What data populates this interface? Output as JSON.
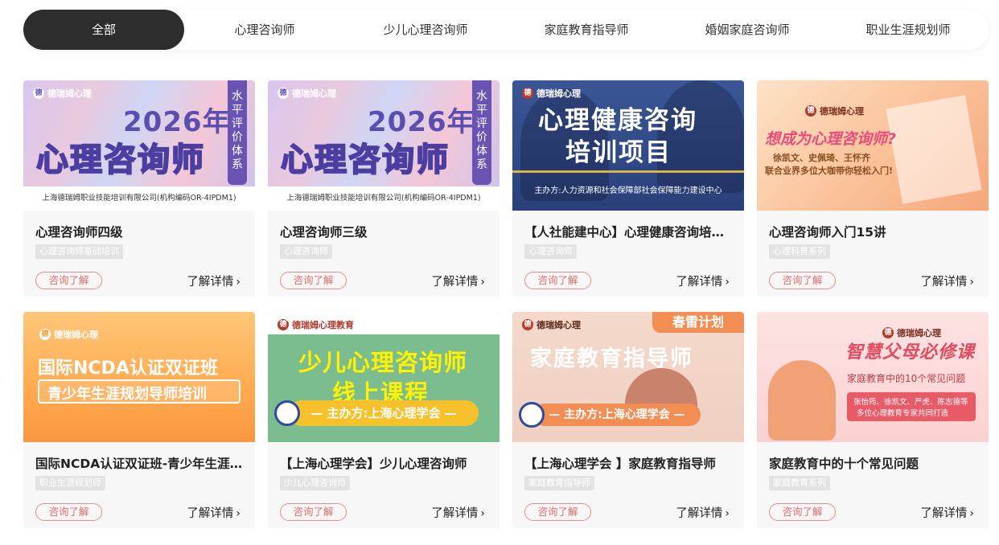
{
  "tabs": [
    {
      "label": "全部",
      "active": true
    },
    {
      "label": "心理咨询师",
      "active": false
    },
    {
      "label": "少儿心理咨询师",
      "active": false
    },
    {
      "label": "家庭教育指导师",
      "active": false
    },
    {
      "label": "婚姻家庭咨询师",
      "active": false
    },
    {
      "label": "职业生涯规划师",
      "active": false
    }
  ],
  "common": {
    "consult_label": "咨询了解",
    "detail_label": "了解详情",
    "chevron": "›"
  },
  "cards": [
    {
      "title": "心理咨询师四级",
      "tag": "心理咨询师基础培训",
      "banner": {
        "logo": "德瑞姆心理",
        "year": "2026年",
        "headline": "心理咨询师",
        "side": "水平评价体系",
        "footer": "上海德瑞姆职业技能培训有限公司(机构编码OR-4IPDM1)"
      }
    },
    {
      "title": "心理咨询师三级",
      "tag": "心理咨询师",
      "banner": {
        "logo": "德瑞姆心理",
        "year": "2026年",
        "headline": "心理咨询师",
        "side": "水平评价体系",
        "footer": "上海德瑞姆职业技能培训有限公司(机构编码OR-4IPDM1)"
      }
    },
    {
      "title": "【人社能建中心】心理健康咨询培训项目",
      "tag": "心理咨询师",
      "banner": {
        "logo": "德瑞姆心理",
        "line1": "心理健康咨询",
        "line2": "培训项目",
        "sub": "主办方:人力资源和社会保障部社会保障能力建设中心"
      }
    },
    {
      "title": "心理咨询师入门15讲",
      "tag": "心理科普系列",
      "banner": {
        "logo": "德瑞姆心理",
        "headline": "想成为心理咨询师?",
        "sub1": "徐凯文、史佩琦、王怀齐",
        "sub2": "联合业界多位大咖带你轻松入门!"
      }
    },
    {
      "title": "国际NCDA认证双证班-青少年生涯规划导师培训",
      "tag": "职业生涯规划师",
      "banner": {
        "logo": "德瑞姆心理",
        "line1": "国际NCDA认证双证班",
        "line2": "青少年生涯规划导师培训"
      }
    },
    {
      "title": "【上海心理学会】少儿心理咨询师",
      "tag": "少儿心理咨询师",
      "banner": {
        "logo": "德瑞姆心理教育",
        "line1": "少儿心理咨询师",
        "line2": "线上课程",
        "pill": "— 主办方:上海心理学会 —"
      }
    },
    {
      "title": "【上海心理学会 】家庭教育指导师",
      "tag": "家庭教育指导师",
      "banner": {
        "logo": "德瑞姆心理",
        "badge": "春雷计划",
        "line1": "家庭教育指导师",
        "pill": "— 主办方:上海心理学会 —"
      }
    },
    {
      "title": "家庭教育中的十个常见问题",
      "tag": "家庭教育系列",
      "banner": {
        "logo": "德瑞姆心理",
        "line1": "智慧父母必修课",
        "line2": "家庭教育中的10个常见问题",
        "box1": "张怡筠、徐凯文、严虎、陈志德等",
        "box2": "多位心理教育专家共同打造"
      }
    }
  ]
}
